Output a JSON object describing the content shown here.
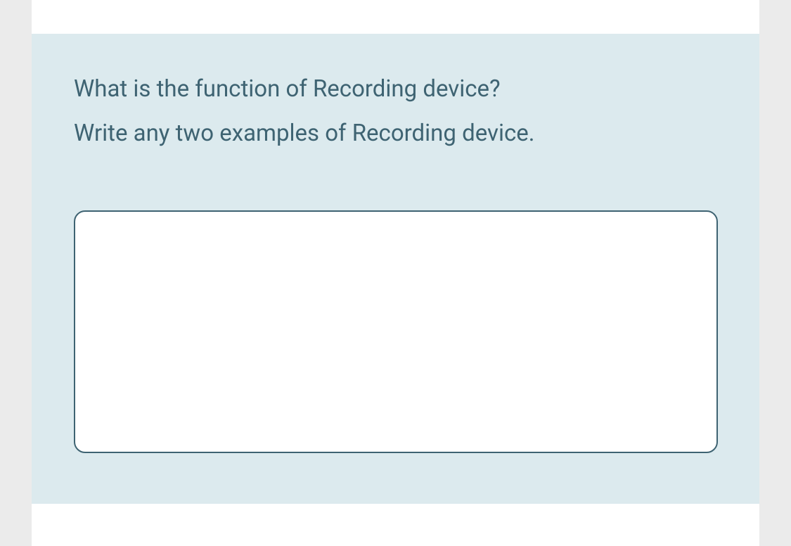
{
  "question": {
    "line1": "What is the function of Recording device?",
    "line2": "Write any two examples of Recording device."
  },
  "answer": {
    "value": "",
    "placeholder": ""
  }
}
